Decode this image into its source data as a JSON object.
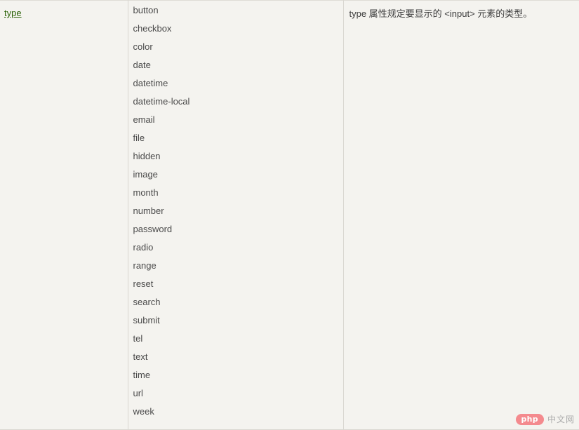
{
  "table": {
    "attribute": {
      "label": "type",
      "link_color": "#2b6207"
    },
    "values": [
      "button",
      "checkbox",
      "color",
      "date",
      "datetime",
      "datetime-local",
      "email",
      "file",
      "hidden",
      "image",
      "month",
      "number",
      "password",
      "radio",
      "range",
      "reset",
      "search",
      "submit",
      "tel",
      "text",
      "time",
      "url",
      "week"
    ],
    "description": "type 属性规定要显示的 <input> 元素的类型。"
  },
  "watermark": {
    "brand": "php",
    "suffix": "中文网",
    "brand_color": "#f4868b",
    "suffix_color": "#a8a8a8"
  },
  "colors": {
    "background": "#f4f3ef",
    "border": "#d8d6d0",
    "text": "#4a4a4a"
  }
}
